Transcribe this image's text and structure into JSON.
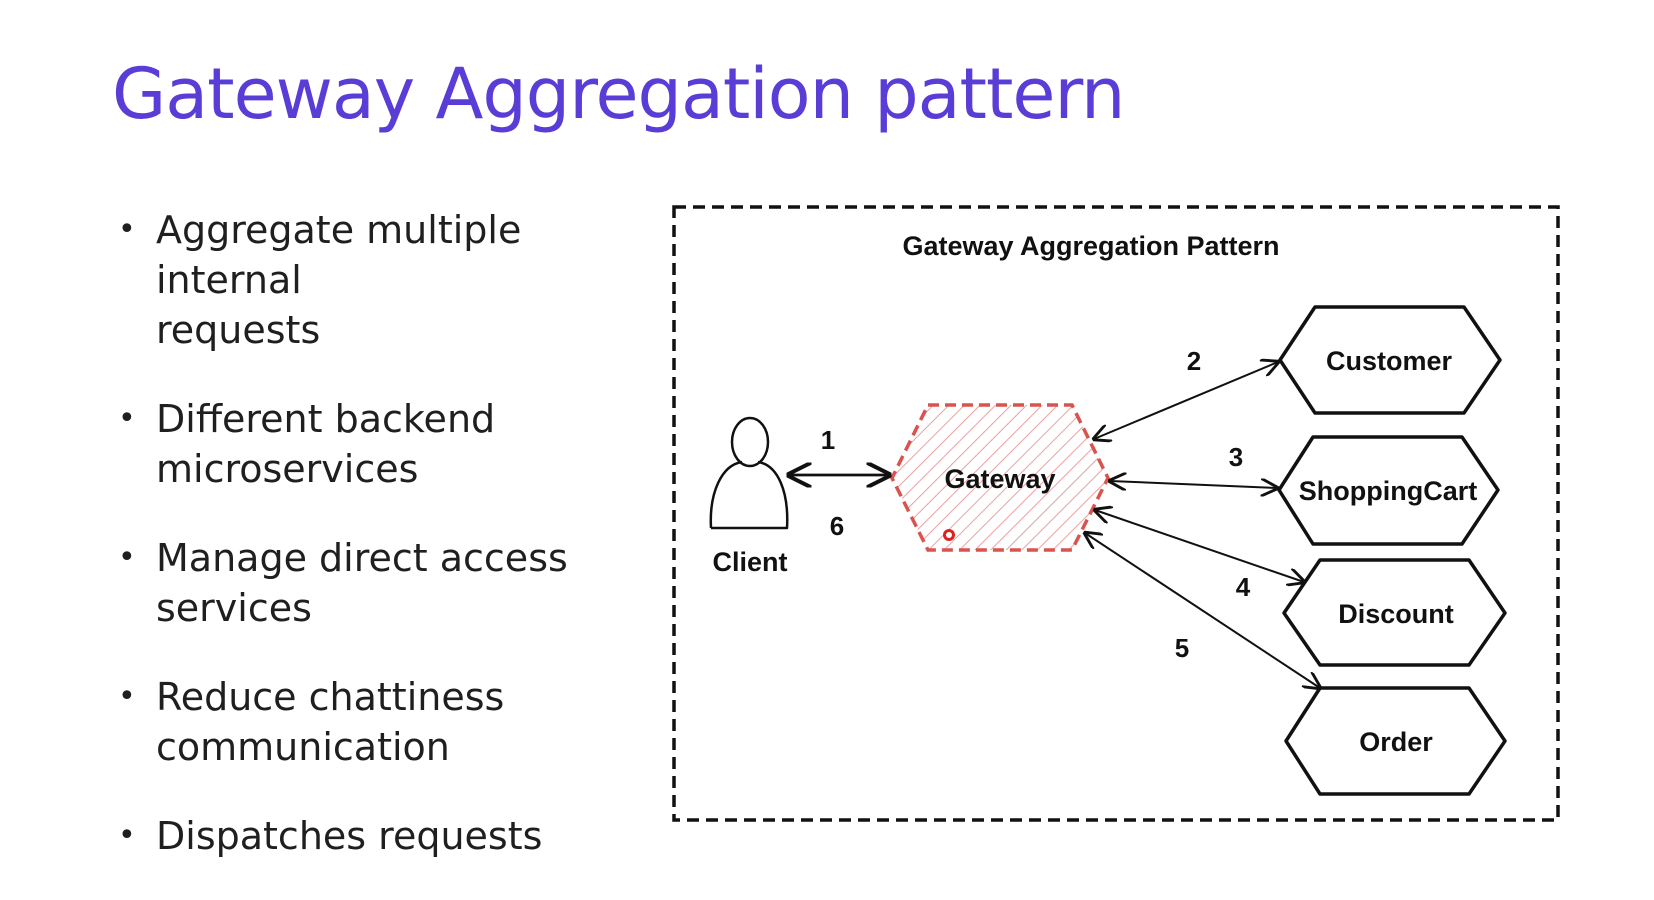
{
  "slide": {
    "title": "Gateway Aggregation pattern",
    "title_color": "#5a3cd6",
    "bullets": [
      {
        "lines": [
          "Aggregate multiple internal",
          "requests"
        ]
      },
      {
        "lines": [
          "Different backend",
          "microservices"
        ]
      },
      {
        "lines": [
          "Manage direct access",
          "services"
        ]
      },
      {
        "lines": [
          "Reduce chattiness",
          "communication"
        ]
      },
      {
        "lines": [
          "Dispatches requests"
        ]
      }
    ]
  },
  "diagram": {
    "title": "Gateway Aggregation Pattern",
    "client_label": "Client",
    "gateway_label": "Gateway",
    "gateway_color": "#d9534f",
    "services": [
      "Customer",
      "ShoppingCart",
      "Discount",
      "Order"
    ],
    "step_labels": [
      "1",
      "6",
      "2",
      "3",
      "4",
      "5"
    ]
  }
}
